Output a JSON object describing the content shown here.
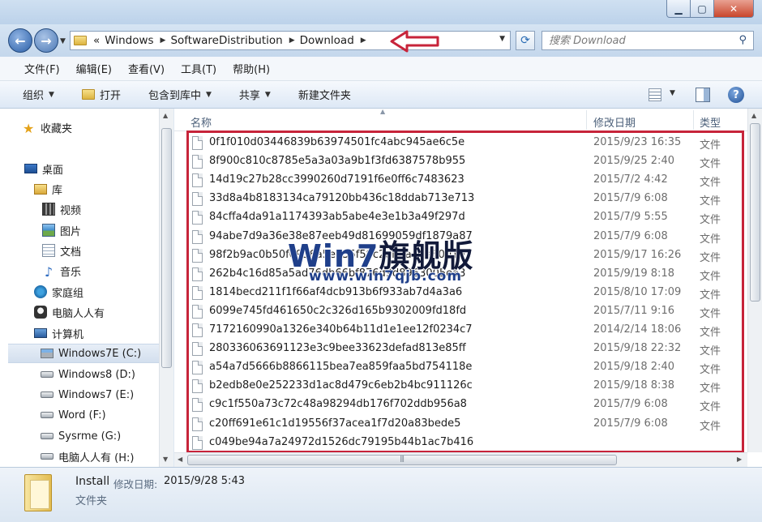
{
  "address": {
    "prefix": "«",
    "crumbs": [
      "Windows",
      "SoftwareDistribution",
      "Download"
    ]
  },
  "search": {
    "placeholder": "搜索 Download"
  },
  "menu": [
    "文件(F)",
    "编辑(E)",
    "查看(V)",
    "工具(T)",
    "帮助(H)"
  ],
  "toolbar": {
    "organize": "组织",
    "open": "打开",
    "include_library": "包含到库中",
    "share": "共享",
    "new_folder": "新建文件夹"
  },
  "nav": [
    {
      "label": "收藏夹",
      "icon": "star-icon"
    },
    {
      "label": "桌面",
      "icon": "desktop-icon"
    },
    {
      "label": "库",
      "icon": "library-icon"
    },
    {
      "label": "视频",
      "icon": "video-icon"
    },
    {
      "label": "图片",
      "icon": "picture-icon"
    },
    {
      "label": "文档",
      "icon": "document-icon"
    },
    {
      "label": "音乐",
      "icon": "music-icon"
    },
    {
      "label": "家庭组",
      "icon": "homegroup-icon"
    },
    {
      "label": "电脑人人有",
      "icon": "network-user-icon"
    },
    {
      "label": "计算机",
      "icon": "computer-icon"
    },
    {
      "label": "Windows7E (C:)",
      "icon": "system-drive-icon"
    },
    {
      "label": "Windows8 (D:)",
      "icon": "drive-icon"
    },
    {
      "label": "Windows7 (E:)",
      "icon": "drive-icon"
    },
    {
      "label": "Word (F:)",
      "icon": "drive-icon"
    },
    {
      "label": "Sysrme (G:)",
      "icon": "drive-icon"
    },
    {
      "label": "电脑人人有 (H:)",
      "icon": "drive-icon"
    }
  ],
  "columns": {
    "name": "名称",
    "date": "修改日期",
    "type": "类型"
  },
  "files": [
    {
      "name": "0f1f010d03446839b63974501fc4abc945ae6c5e",
      "date": "2015/9/23 16:35",
      "type": "文件"
    },
    {
      "name": "8f900c810c8785e5a3a03a9b1f3fd6387578b955",
      "date": "2015/9/25 2:40",
      "type": "文件"
    },
    {
      "name": "14d19c27b28cc3990260d7191f6e0ff6c7483623",
      "date": "2015/7/2 4:42",
      "type": "文件"
    },
    {
      "name": "33d8a4b8183134ca79120bb436c18ddab713e713",
      "date": "2015/7/9 6:08",
      "type": "文件"
    },
    {
      "name": "84cffa4da91a1174393ab5abe4e3e1b3a49f297d",
      "date": "2015/7/9 5:55",
      "type": "文件"
    },
    {
      "name": "94abe7d9a36e38e87eeb49d81699059df1879a87",
      "date": "2015/7/9 6:08",
      "type": "文件"
    },
    {
      "name": "98f2b9ac0b50f0936a5eb35f59c2ab5a49e60010",
      "date": "2015/9/17 16:26",
      "type": "文件"
    },
    {
      "name": "262b4c16d85a5ad76db66bf876d9d8963005ea3",
      "date": "2015/9/19 8:18",
      "type": "文件"
    },
    {
      "name": "1814becd211f1f66af4dcb913b6f933ab7d4a3a6",
      "date": "2015/8/10 17:09",
      "type": "文件"
    },
    {
      "name": "6099e745fd461650c2c326d165b9302009fd18fd",
      "date": "2015/7/11 9:16",
      "type": "文件"
    },
    {
      "name": "7172160990a1326e340b64b11d1e1ee12f0234c7",
      "date": "2014/2/14 18:06",
      "type": "文件"
    },
    {
      "name": "280336063691123e3c9bee33623defad813e85ff",
      "date": "2015/9/18 22:32",
      "type": "文件"
    },
    {
      "name": "a54a7d5666b8866115bea7ea859faa5bd754118e",
      "date": "2015/9/18 2:40",
      "type": "文件"
    },
    {
      "name": "b2edb8e0e252233d1ac8d479c6eb2b4bc911126c",
      "date": "2015/9/18 8:38",
      "type": "文件"
    },
    {
      "name": "c9c1f550a73c72c48a98294db176f702ddb956a8",
      "date": "2015/7/9 6:08",
      "type": "文件"
    },
    {
      "name": "c20ff691e61c1d19556f37acea1f7d20a83bede5",
      "date": "2015/7/9 6:08",
      "type": "文件"
    },
    {
      "name": "c049be94a7a24972d1526dc79195b44b1ac7b416",
      "date": "",
      "type": ""
    }
  ],
  "watermark": {
    "brand": "Win7",
    "brand_cn": "旗舰版",
    "url": "www.win7qjb.com"
  },
  "details": {
    "name": "Install",
    "date_label": "修改日期:",
    "date": "2015/9/28 5:43",
    "type": "文件夹"
  },
  "colors": {
    "highlight_red": "#c7243a",
    "accent_blue": "#2b5fa7"
  }
}
